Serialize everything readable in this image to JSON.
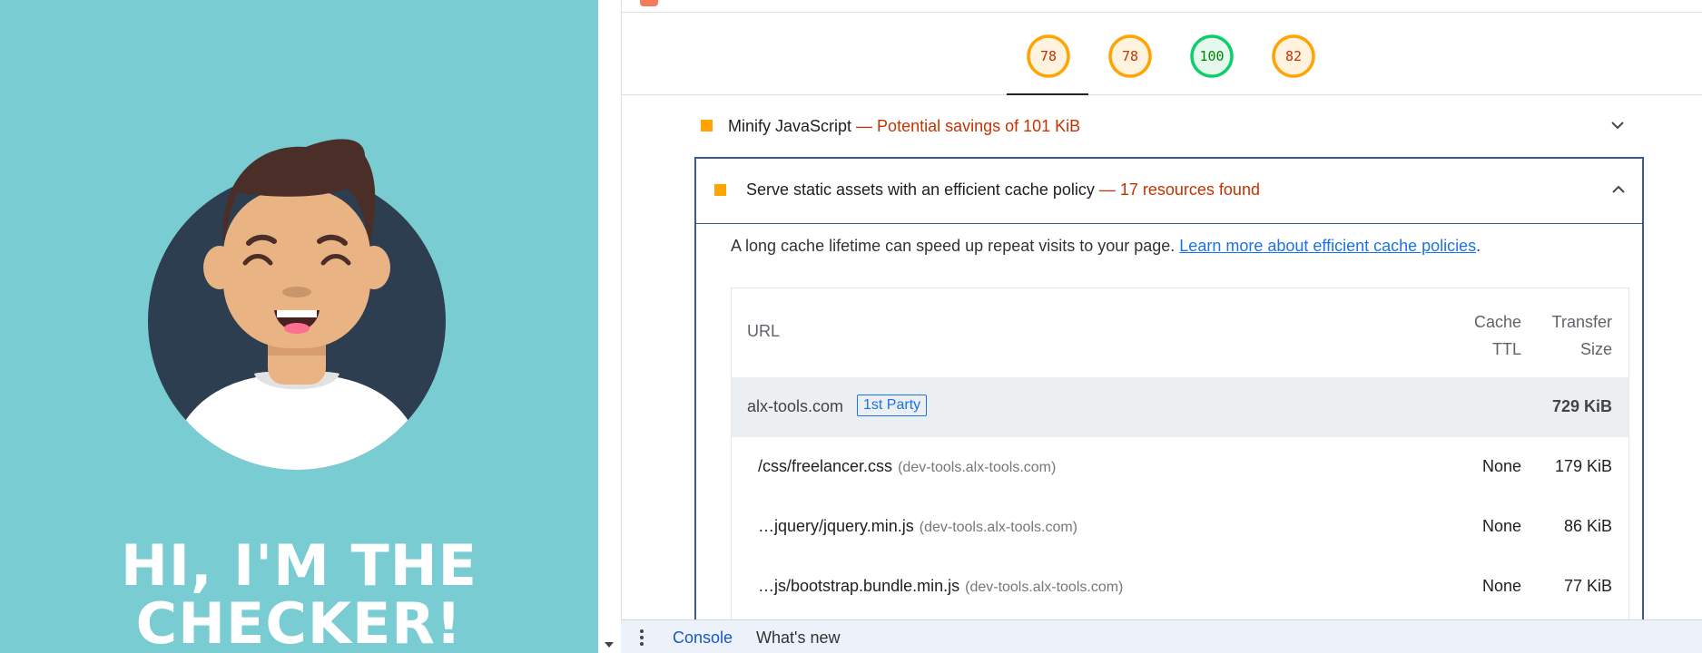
{
  "site": {
    "hero_line1": "HI, I'M THE",
    "hero_line2": "CHECKER!"
  },
  "lighthouse": {
    "scores": [
      {
        "value": "78",
        "color": "#ffa400",
        "bg": "#fff3e0",
        "text": "#c33300"
      },
      {
        "value": "78",
        "color": "#ffa400",
        "bg": "#fff3e0",
        "text": "#c33300"
      },
      {
        "value": "100",
        "color": "#0cce6b",
        "bg": "#e6f8ee",
        "text": "#008800"
      },
      {
        "value": "82",
        "color": "#ffa400",
        "bg": "#fff3e0",
        "text": "#c33300"
      }
    ],
    "audit_minify": {
      "title": "Minify JavaScript",
      "savings": " — Potential savings of 101 KiB"
    },
    "audit_cache": {
      "title": "Serve static assets with an efficient cache policy",
      "savings": " — 17 resources found",
      "description": "A long cache lifetime can speed up repeat visits to your page. ",
      "learn_more": "Learn more about efficient cache policies",
      "period": ".",
      "table": {
        "col_url": "URL",
        "col_ttl_1": "Cache",
        "col_ttl_2": "TTL",
        "col_size_1": "Transfer",
        "col_size_2": "Size",
        "group": {
          "name": "alx-tools.com",
          "badge": "1st Party",
          "total": "729 KiB"
        },
        "rows": [
          {
            "path": "/css/freelancer.css",
            "host": "(dev-tools.alx-tools.com)",
            "ttl": "None",
            "size": "179 KiB"
          },
          {
            "path": "…jquery/jquery.min.js",
            "host": "(dev-tools.alx-tools.com)",
            "ttl": "None",
            "size": "86 KiB"
          },
          {
            "path": "…js/bootstrap.bundle.min.js",
            "host": "(dev-tools.alx-tools.com)",
            "ttl": "None",
            "size": "77 KiB"
          }
        ]
      }
    }
  },
  "drawer": {
    "tab_console": "Console",
    "tab_whats_new": "What's new"
  }
}
